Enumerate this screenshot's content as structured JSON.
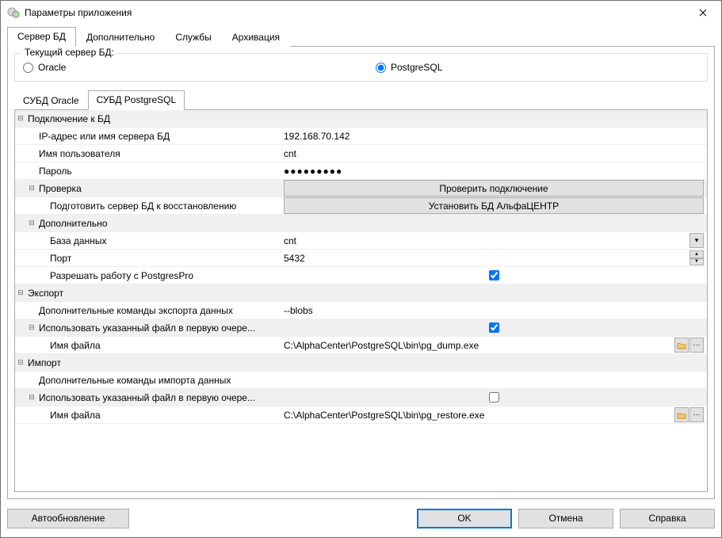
{
  "window": {
    "title": "Параметры приложения"
  },
  "tabs": {
    "server": "Сервер БД",
    "extra": "Дополнительно",
    "services": "Службы",
    "archive": "Архивация"
  },
  "current_server": {
    "legend": "Текущий сервер БД:",
    "oracle": "Oracle",
    "postgres": "PostgreSQL"
  },
  "inner_tabs": {
    "oracle": "СУБД Oracle",
    "postgres": "СУБД PostgreSQL"
  },
  "props": {
    "connection": {
      "header": "Подключение к БД",
      "ip_label": "IP-адрес или имя сервера БД",
      "ip_value": "192.168.70.142",
      "user_label": "Имя пользователя",
      "user_value": "cnt",
      "pass_label": "Пароль",
      "pass_value": "●●●●●●●●●",
      "check_header": "Проверка",
      "check_btn": "Проверить подключение",
      "prepare_label": "Подготовить сервер БД к восстановлению",
      "install_btn": "Установить БД АльфаЦЕНТР",
      "extra_header": "Дополнительно",
      "db_label": "База данных",
      "db_value": "cnt",
      "port_label": "Порт",
      "port_value": "5432",
      "pgpro_label": "Разрешать работу с PostgresPro"
    },
    "export": {
      "header": "Экспорт",
      "extra_cmd_label": "Дополнительные команды экспорта данных",
      "extra_cmd_value": "--blobs",
      "use_file_label": "Использовать указанный файл в первую очере...",
      "file_label": "Имя файла",
      "file_value": "C:\\AlphaCenter\\PostgreSQL\\bin\\pg_dump.exe"
    },
    "import": {
      "header": "Импорт",
      "extra_cmd_label": "Дополнительные команды импорта данных",
      "use_file_label": "Использовать указанный файл в первую очере...",
      "file_label": "Имя файла",
      "file_value": "C:\\AlphaCenter\\PostgreSQL\\bin\\pg_restore.exe"
    }
  },
  "footer": {
    "autoupdate": "Автообновление",
    "ok": "OK",
    "cancel": "Отмена",
    "help": "Справка"
  }
}
